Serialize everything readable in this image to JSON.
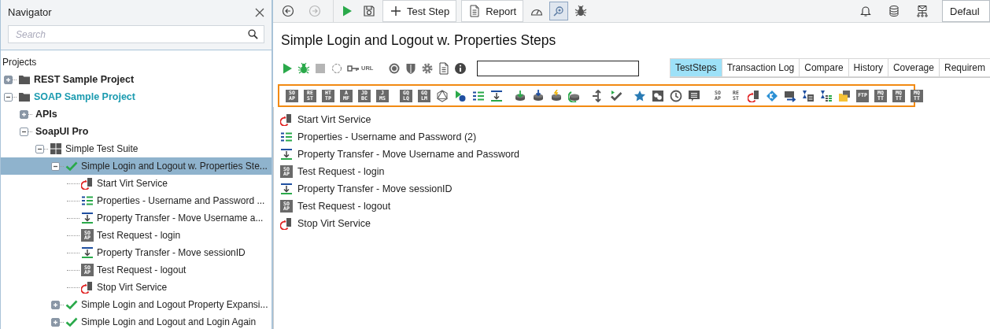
{
  "navigator": {
    "title": "Navigator",
    "search": {
      "placeholder": "Search"
    },
    "section_label": "Projects",
    "tree": [
      {
        "label": "REST Sample Project",
        "kind": "project",
        "bold": true,
        "active": false,
        "expanded": false,
        "selected": false
      },
      {
        "label": "SOAP Sample Project",
        "kind": "project",
        "bold": true,
        "active": true,
        "expanded": true,
        "selected": false,
        "children": [
          {
            "label": "APIs",
            "bold": true,
            "expanded": false,
            "selected": false
          },
          {
            "label": "SoapUI Pro",
            "bold": true,
            "expanded": true,
            "selected": false,
            "children": [
              {
                "label": "Simple Test Suite",
                "kind": "suite",
                "expanded": true,
                "selected": false,
                "children": [
                  {
                    "label": "Simple Login and Logout w. Properties Ste...",
                    "kind": "testcase",
                    "expanded": true,
                    "selected": true,
                    "children": [
                      {
                        "label": "Start Virt Service",
                        "kind": "virt",
                        "selected": false
                      },
                      {
                        "label": "Properties - Username and Password ...",
                        "kind": "properties",
                        "selected": false
                      },
                      {
                        "label": "Property Transfer - Move Username a...",
                        "kind": "transfer",
                        "selected": false
                      },
                      {
                        "label": "Test Request - login",
                        "kind": "soap",
                        "icon_text": [
                          "SO",
                          "AP"
                        ],
                        "selected": false
                      },
                      {
                        "label": "Property Transfer - Move sessionID",
                        "kind": "transfer",
                        "selected": false
                      },
                      {
                        "label": "Test Request - logout",
                        "kind": "soap",
                        "icon_text": [
                          "SO",
                          "AP"
                        ],
                        "selected": false
                      },
                      {
                        "label": "Stop Virt Service",
                        "kind": "virt",
                        "selected": false
                      }
                    ]
                  },
                  {
                    "label": "Simple Login and Logout Property Expansi...",
                    "kind": "testcase",
                    "expanded": false,
                    "selected": false
                  },
                  {
                    "label": "Simple Login and Logout and Login Again",
                    "kind": "testcase",
                    "expanded": false,
                    "selected": false
                  }
                ]
              }
            ]
          }
        ]
      }
    ]
  },
  "toolbar": {
    "left": [
      {
        "kind": "back",
        "disabled": false
      },
      {
        "kind": "forward",
        "disabled": true
      }
    ],
    "actions": [
      {
        "kind": "run"
      },
      {
        "kind": "save"
      }
    ],
    "buttons": [
      {
        "kind": "plus",
        "label": "Test Step"
      },
      {
        "kind": "doc",
        "label": "Report"
      }
    ],
    "tools": [
      {
        "kind": "gauge",
        "selected": false
      },
      {
        "kind": "search-gear",
        "selected": true
      },
      {
        "kind": "bug",
        "selected": false
      }
    ],
    "right": [
      {
        "kind": "bell"
      },
      {
        "kind": "database"
      },
      {
        "kind": "mail-network"
      }
    ],
    "environment": "Defaul"
  },
  "editor": {
    "title": "Simple Login and Logout w. Properties Steps",
    "controls": [
      {
        "kind": "run"
      },
      {
        "kind": "bug"
      },
      {
        "kind": "stop"
      },
      {
        "kind": "cycle"
      },
      {
        "kind": "key"
      },
      {
        "kind": "text",
        "label": "URL"
      },
      {
        "kind": "target"
      },
      {
        "kind": "shield"
      },
      {
        "kind": "gear"
      },
      {
        "kind": "doc"
      },
      {
        "kind": "info"
      }
    ],
    "tabs": [
      {
        "label": "TestSteps",
        "selected": true
      },
      {
        "label": "Transaction Log",
        "selected": false
      },
      {
        "label": "Compare",
        "selected": false
      },
      {
        "label": "History",
        "selected": false
      },
      {
        "label": "Coverage",
        "selected": false
      },
      {
        "label": "Requirem",
        "selected": false
      }
    ],
    "palette": [
      [
        {
          "kind": "tile",
          "label": [
            "SO",
            "AP"
          ]
        },
        {
          "kind": "tile",
          "label": [
            "RE",
            "ST"
          ]
        },
        {
          "kind": "tile",
          "label": [
            "HT",
            "TP"
          ]
        },
        {
          "kind": "tile",
          "label": [
            "A",
            "MF"
          ]
        },
        {
          "kind": "tile",
          "label": [
            "JD",
            "BC"
          ]
        },
        {
          "kind": "tile",
          "label": [
            "J",
            "MS"
          ]
        }
      ],
      [
        {
          "kind": "tile",
          "label": [
            "GQ",
            "LQ"
          ]
        },
        {
          "kind": "tile",
          "label": [
            "GQ",
            "LM"
          ]
        },
        {
          "kind": "graphql"
        },
        {
          "kind": "run-dot"
        },
        {
          "kind": "properties"
        },
        {
          "kind": "transfer"
        }
      ],
      [
        {
          "kind": "db-down"
        },
        {
          "kind": "db-import"
        },
        {
          "kind": "db-bolt"
        },
        {
          "kind": "db-refresh"
        }
      ],
      [
        {
          "kind": "arrows"
        },
        {
          "kind": "check-run"
        }
      ],
      [
        {
          "kind": "star"
        },
        {
          "kind": "squares"
        },
        {
          "kind": "clock"
        },
        {
          "kind": "comment"
        }
      ],
      [
        {
          "kind": "outline-tile",
          "label": [
            "SO",
            "AP"
          ]
        },
        {
          "kind": "outline-tile",
          "label": [
            "RE",
            "ST"
          ]
        },
        {
          "kind": "virt"
        },
        {
          "kind": "diamond"
        },
        {
          "kind": "screen-arrow"
        },
        {
          "kind": "hourglass-doc"
        },
        {
          "kind": "hourglass-list"
        },
        {
          "kind": "folder-stack"
        },
        {
          "kind": "tile",
          "label": [
            "FTP"
          ]
        },
        {
          "kind": "tile",
          "label": [
            "MQ",
            "TT"
          ]
        },
        {
          "kind": "tile",
          "label": [
            "MQ",
            "TT"
          ]
        },
        {
          "kind": "tile",
          "label": [
            "MQ",
            "TT"
          ]
        }
      ]
    ],
    "steps": [
      {
        "label": "Start Virt Service",
        "kind": "virt"
      },
      {
        "label": "Properties - Username and Password (2)",
        "kind": "properties"
      },
      {
        "label": "Property Transfer - Move Username and Password",
        "kind": "transfer"
      },
      {
        "label": "Test Request - login",
        "kind": "soap",
        "icon_text": [
          "SO",
          "AP"
        ]
      },
      {
        "label": "Property Transfer - Move sessionID",
        "kind": "transfer"
      },
      {
        "label": "Test Request - logout",
        "kind": "soap",
        "icon_text": [
          "SO",
          "AP"
        ]
      },
      {
        "label": "Stop Virt Service",
        "kind": "virt"
      }
    ]
  }
}
